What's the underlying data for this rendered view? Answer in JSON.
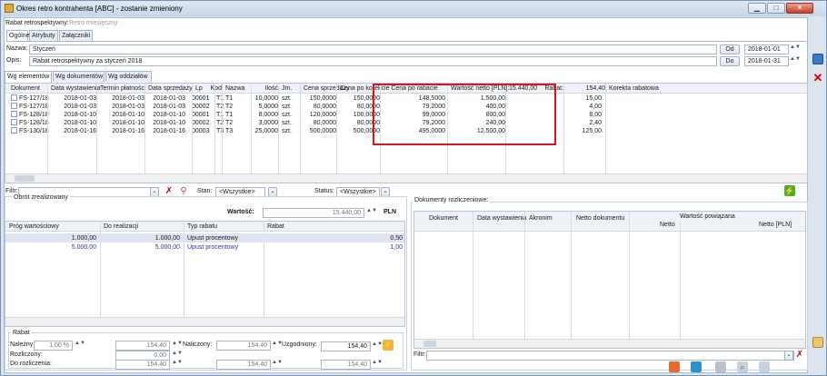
{
  "window": {
    "title": "Okres retro kontrahenta [ABC] - zostanie zmieniony"
  },
  "header": {
    "rabat_label": "Rabat retrospektywny:",
    "rabat_value": "Retro miesięczny"
  },
  "main_tabs": [
    "Ogólne",
    "Atrybuty",
    "Załączniki"
  ],
  "form": {
    "nazwa_label": "Nazwa:",
    "nazwa_value": "Styczeń",
    "opis_label": "Opis:",
    "opis_value": "Rabat retrospektywny za styczeń 2018",
    "od_label": "Od",
    "od_value": "2018-01-01",
    "do_label": "Do",
    "do_value": "2018-01-31"
  },
  "sub_tabs": [
    "Wg elementów",
    "Wg dokumentów",
    "Wg oddziałów"
  ],
  "table": {
    "headers": [
      "Dokument",
      "Data wystawienia",
      "Termin płatności",
      "Data sprzedaży",
      "Lp",
      "Kod",
      "Nazwa",
      "Ilość",
      "Jm.",
      "Cena sprzedaży",
      "Cena po korekcie",
      "Cena po rabacie",
      "Wartość netto [PLN]:",
      "15.440,00",
      "Rabat:",
      "154,40",
      "Korekta rabatowa"
    ],
    "rows": [
      [
        "FS-127/18",
        "2018-01-03",
        "2018-01-03",
        "2018-01-03",
        "00001",
        "T1",
        "T1",
        "10,0000",
        "szt.",
        "150,0000",
        "150,0000",
        "148,5000",
        "1.500,00",
        "15,00"
      ],
      [
        "FS-127/18",
        "2018-01-03",
        "2018-01-03",
        "2018-01-03",
        "00002",
        "T2",
        "T2",
        "5,0000",
        "szt.",
        "80,0000",
        "80,0000",
        "79,2000",
        "400,00",
        "4,00"
      ],
      [
        "FS-128/18",
        "2018-01-10",
        "2018-01-10",
        "2018-01-10",
        "00001",
        "T1",
        "T1",
        "8,0000",
        "szt.",
        "120,0000",
        "100,0000",
        "99,0000",
        "800,00",
        "8,00"
      ],
      [
        "FS-128/18",
        "2018-01-10",
        "2018-01-10",
        "2018-01-10",
        "00002",
        "T2",
        "T2",
        "3,0000",
        "szt.",
        "80,0000",
        "80,0000",
        "79,2000",
        "240,00",
        "2,40"
      ],
      [
        "FS-130/18",
        "2018-01-16",
        "2018-01-16",
        "2018-01-16",
        "00003",
        "T3",
        "T3",
        "25,0000",
        "szt.",
        "500,0000",
        "500,0000",
        "495,0000",
        "12.500,00",
        "125,00"
      ]
    ]
  },
  "filter": {
    "label": "Filtr:",
    "stan_label": "Stan:",
    "stan_value": "<Wszystkie>",
    "status_label": "Status:",
    "status_value": "<Wszystkie>"
  },
  "obrot": {
    "title": "Obrót zrealizowany",
    "wartosc_label": "Wartość:",
    "wartosc_value": "15.440,00",
    "currency": "PLN",
    "headers": [
      "Próg wartościowy",
      "Do realizacji",
      "Typ rabatu",
      "Rabat"
    ],
    "rows": [
      [
        "1.000,00",
        "1.000,00",
        "Upust procentowy",
        "0,50"
      ],
      [
        "5.000,00",
        "5.000,00",
        "Upust procentowy",
        "1,00"
      ]
    ]
  },
  "rabat_section": {
    "title": "Rabat",
    "nalezny_label": "Należny",
    "nalezny_pct": "1,00 %",
    "nalezny_value": "154,40",
    "naliczony_label": "Naliczony:",
    "naliczony_value": "154,40",
    "uzgodniony_label": "Uzgodniony:",
    "uzgodniony_value": "154,40",
    "rozliczony_label": "Rozliczony:",
    "rozliczony_value": "0,00",
    "do_rozliczenia_label": "Do rozliczenia:",
    "do_rozliczenia_value1": "154,40",
    "do_rozliczenia_value2": "154,40",
    "do_rozliczenia_value3": "154,40"
  },
  "dokumenty": {
    "title": "Dokumenty rozliczeniowe:",
    "headers": [
      "Dokument",
      "Data wystawienia",
      "Akronim",
      "Netto dokumentu",
      "Wartość powiązana",
      "Netto",
      "Netto [PLN]"
    ],
    "filter_label": "Filtr:"
  }
}
